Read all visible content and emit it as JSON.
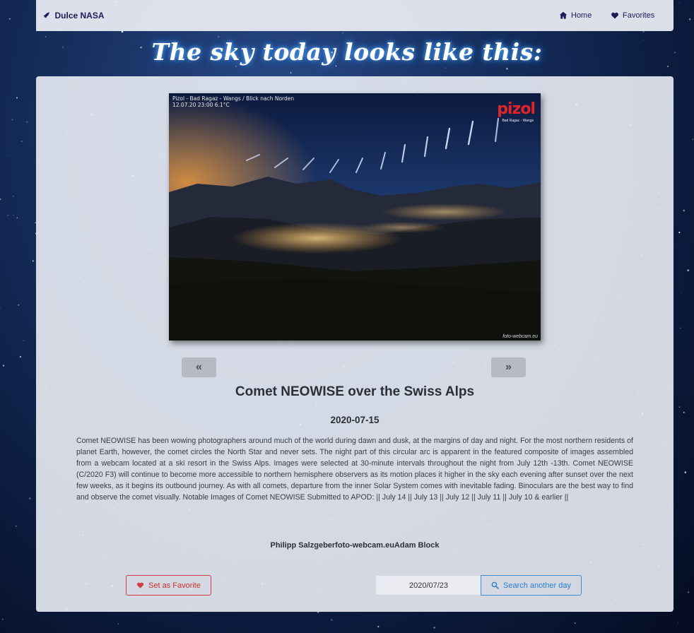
{
  "nav": {
    "brand": "Dulce NASA",
    "links": [
      {
        "label": "Home",
        "icon": "home-icon"
      },
      {
        "label": "Favorites",
        "icon": "heart-icon"
      }
    ]
  },
  "heading": "The sky today looks like this:",
  "apod": {
    "image_overlay": {
      "caption_line1": "Pizol - Bad Ragaz - Wangs / Blick nach Norden",
      "caption_line2": "12.07.20 23:00    6.1°C",
      "logo": "pizol",
      "logo_sub": "Bad Ragaz - Wangs",
      "credit": "foto-webcam.eu"
    },
    "prev_label": "«",
    "next_label": "»",
    "title": "Comet NEOWISE over the Swiss Alps",
    "date": "2020-07-15",
    "explanation": "Comet NEOWISE has been wowing photographers around much of the world during dawn and dusk, at the margins of day and night. For the most northern residents of planet Earth, however, the comet circles the North Star and never sets. The night part of this circular arc is apparent in the featured composite of images assembled from a webcam located at a ski resort in the Swiss Alps. Images were selected at 30-minute intervals throughout the night from July 12th -13th. Comet NEOWISE (C/2020 F3) will continue to become more accessible to northern hemisphere observers as its motion places it higher in the sky each evening after sunset over the next few weeks, as it begins its outbound journey. As with all comets, departure from the inner Solar System comes with inevitable fading. Binoculars are the best way to find and observe the comet visually. Notable Images of Comet NEOWISE Submitted to APOD: || July 14 || July 13 || July 12 || July 11 || July 10 & earlier ||",
    "copyright": "Philipp Salzgeberfoto-webcam.euAdam Block"
  },
  "actions": {
    "favorite_label": "Set as Favorite",
    "date_value": "2020/07/23",
    "search_label": "Search another day"
  },
  "colors": {
    "brand": "#1d1a5c",
    "favorite": "#d33c43",
    "search": "#2a7fd0"
  }
}
